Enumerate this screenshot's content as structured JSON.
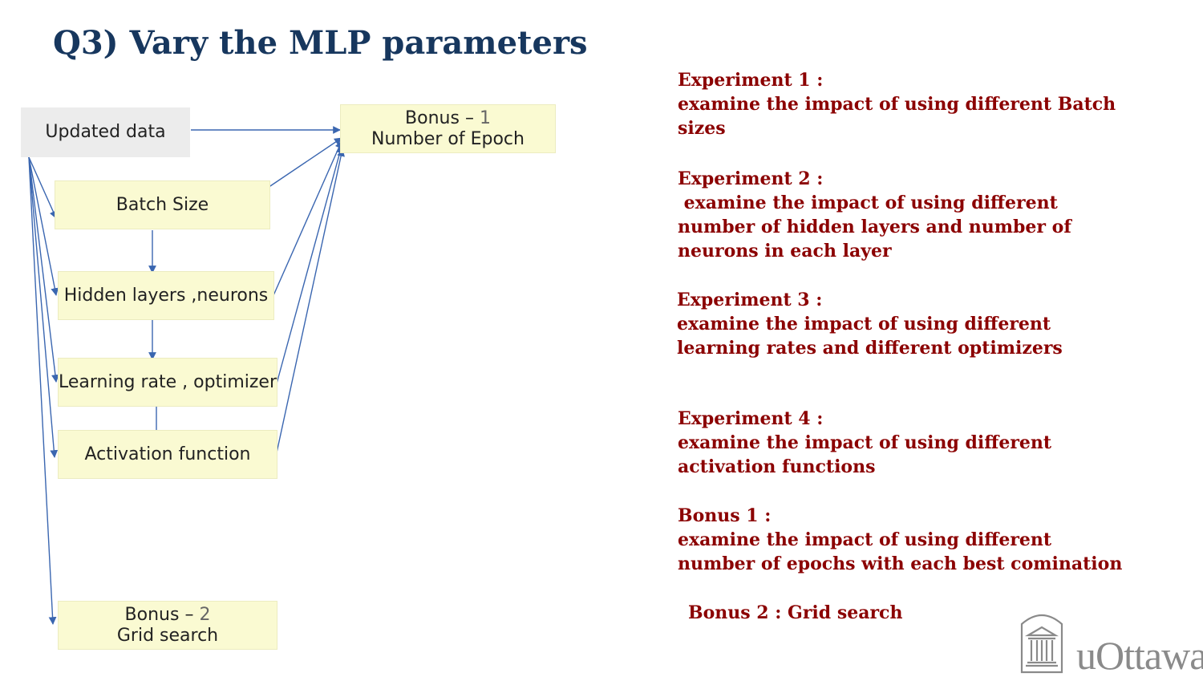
{
  "title": "Q3) Vary the MLP parameters",
  "diagram": {
    "updated_data": "Updated data",
    "bonus1_prefix": "Bonus – ",
    "bonus1_num": "1",
    "bonus1_line2": "Number of Epoch",
    "batch_size": "Batch Size",
    "hidden_layers": "Hidden layers ,neurons",
    "learning_rate": "Learning rate , optimizer",
    "activation": "Activation function",
    "bonus2_prefix": "Bonus – ",
    "bonus2_num": "2",
    "bonus2_line2": "Grid search"
  },
  "experiments": {
    "e1_title": "Experiment 1 :",
    "e1_l1": "examine the impact of using different Batch",
    "e1_l2": "sizes",
    "e2_title": "Experiment 2 :",
    "e2_l1": " examine the impact of using different",
    "e2_l2": "number of hidden layers and number of",
    "e2_l3": "neurons in each layer",
    "e3_title": "Experiment 3 :",
    "e3_l1": "examine the impact of using different",
    "e3_l2": "learning rates and different optimizers",
    "e4_title": "Experiment 4 :",
    "e4_l1": "examine the impact of using different",
    "e4_l2": "activation functions",
    "b1_title": "Bonus 1 :",
    "b1_l1": "examine the impact of using different",
    "b1_l2": "number of epochs with each best comination",
    "b2": "Bonus 2 : Grid search"
  },
  "logo": {
    "text": "uOttawa",
    "icon": "university-building-icon"
  }
}
